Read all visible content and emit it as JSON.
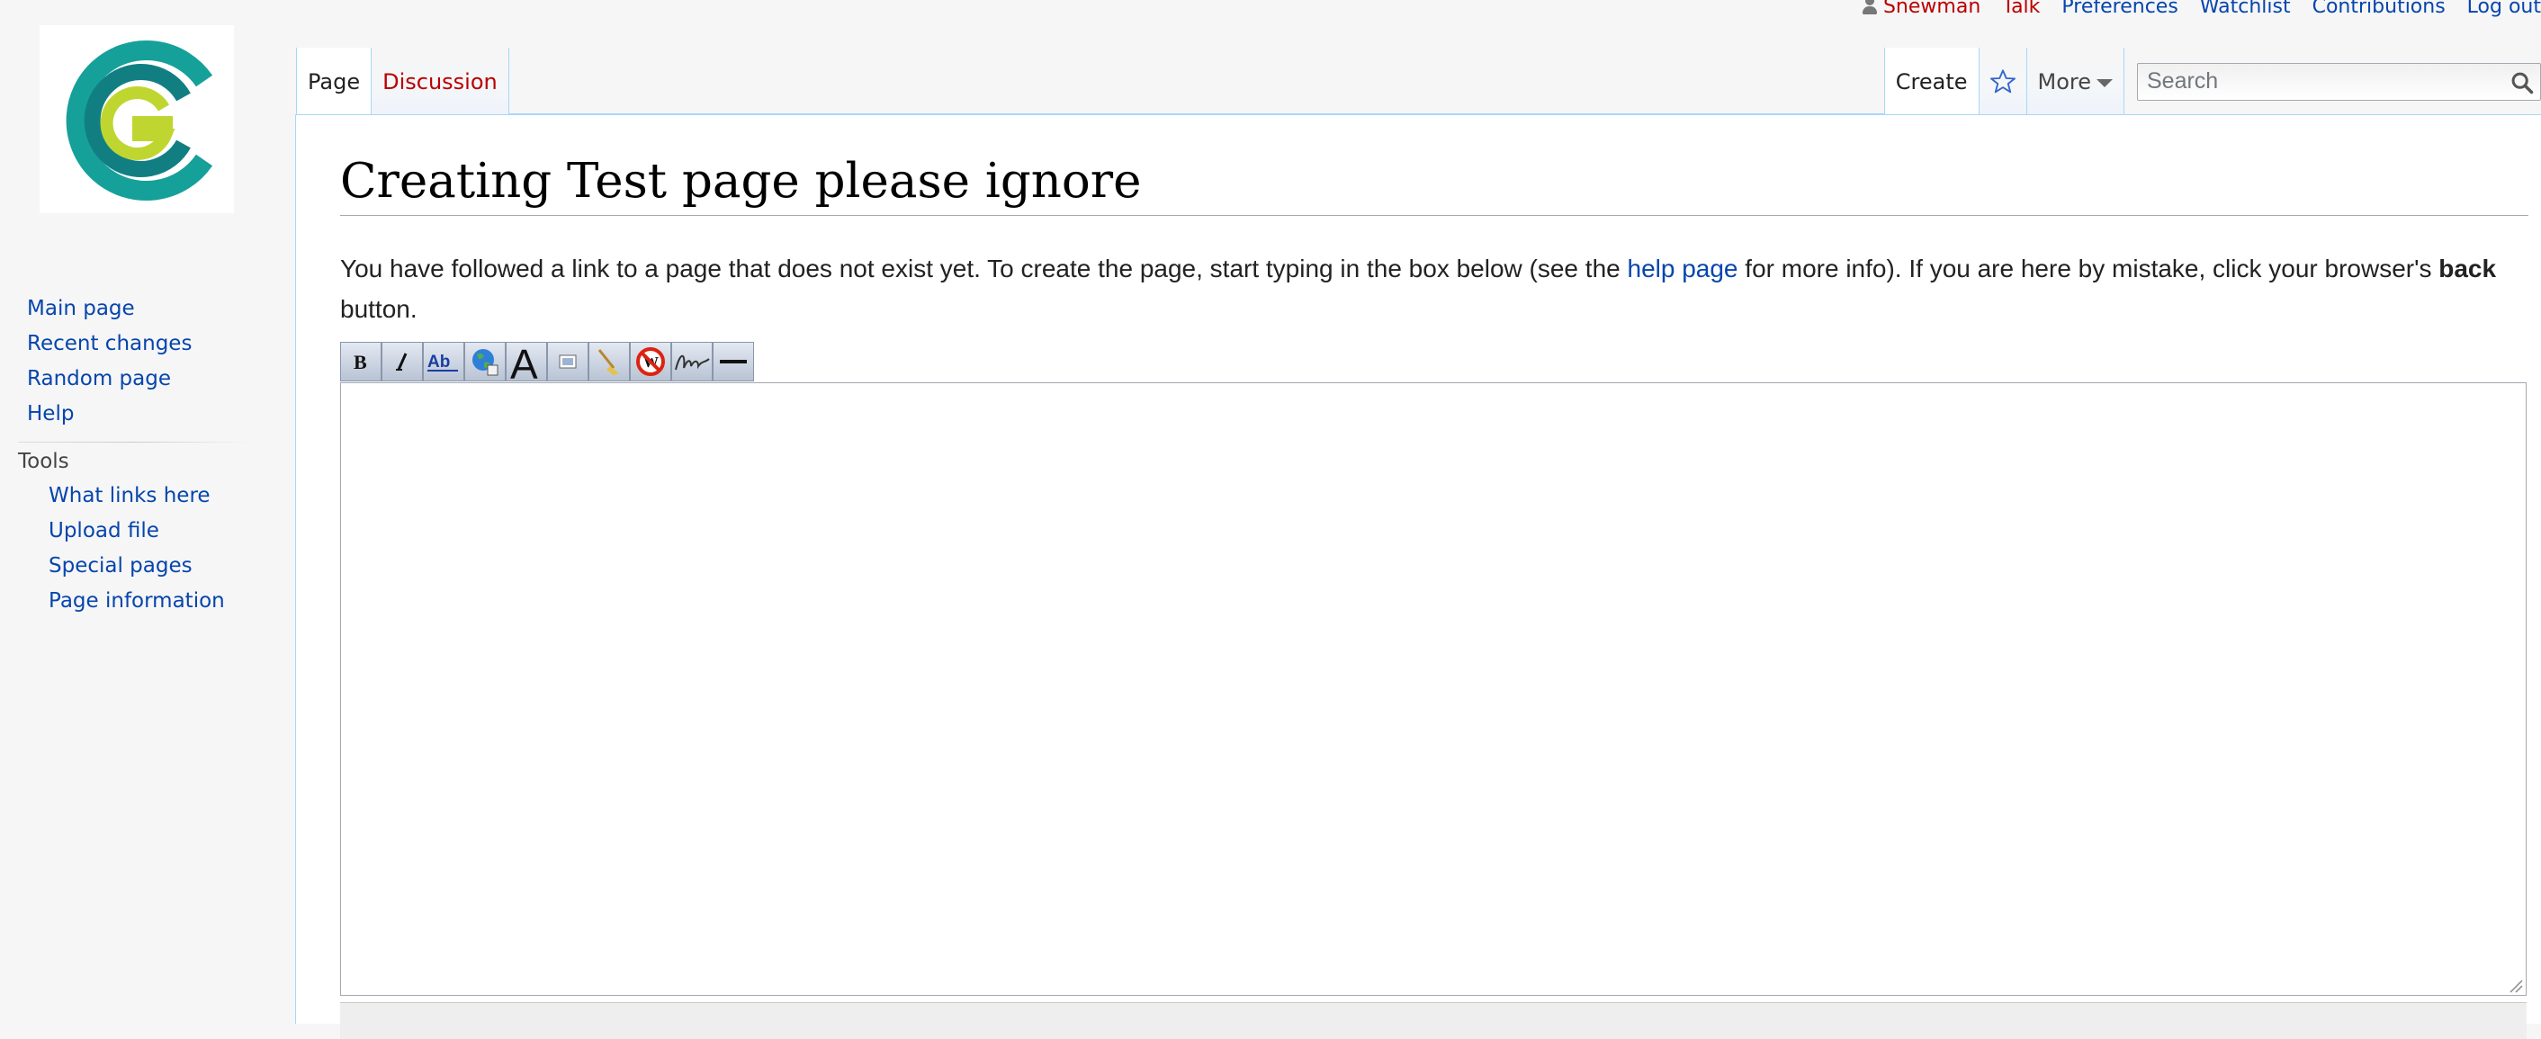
{
  "personal_tools": {
    "username": "Snewman",
    "talk": "Talk",
    "preferences": "Preferences",
    "watchlist": "Watchlist",
    "contributions": "Contributions",
    "logout": "Log out"
  },
  "logo": {
    "icon": "site-logo-cg",
    "colors": {
      "teal": "#16a09a",
      "lime": "#bfd630",
      "dark_teal": "#117f82"
    }
  },
  "sidebar": {
    "navigation": [
      "Main page",
      "Recent changes",
      "Random page",
      "Help"
    ],
    "tools_heading": "Tools",
    "tools": [
      "What links here",
      "Upload file",
      "Special pages",
      "Page information"
    ]
  },
  "tabs": {
    "page": "Page",
    "discussion": "Discussion",
    "create": "Create",
    "more": "More",
    "watch_icon": "star-icon"
  },
  "search": {
    "placeholder": "Search",
    "value": ""
  },
  "content": {
    "heading": "Creating Test page please ignore",
    "intro_before_link": "You have followed a link to a page that does not exist yet. To create the page, start typing in the box below (see the ",
    "help_link": "help page",
    "intro_after_link": " for more info). If you are here by mistake, click your browser's ",
    "back_word": "back",
    "intro_end": " button."
  },
  "editor": {
    "toolbar_buttons": [
      "Bold text",
      "Italic text",
      "Internal link",
      "External link",
      "Level 2 headline",
      "Embedded file",
      "Ignore wiki formatting",
      "Your signature with timestamp",
      "Horizontal line"
    ],
    "text": ""
  },
  "colors": {
    "link": "#0645ad",
    "redlink": "#ba0000",
    "tab_border": "#a7d7f9",
    "sidebar_bg": "#f6f6f6"
  }
}
